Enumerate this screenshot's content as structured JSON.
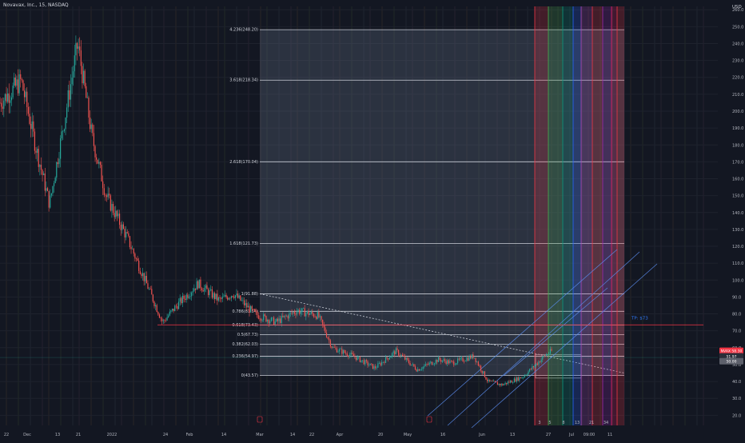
{
  "header": {
    "title": "Novavax, Inc., 15, NASDAQ",
    "currency": "USD"
  },
  "colors": {
    "background": "#131722",
    "up": "#26a69a",
    "down": "#ef5350",
    "fib_line": "#d9dde6",
    "fib_fill": "#5f6b80",
    "tp_line": "#f23645",
    "tp_label": "#3179f5",
    "channel": "#5b8def",
    "price_badge": "#f23645"
  },
  "chart_data": {
    "type": "candlestick",
    "instrument": "Novavax, Inc.",
    "interval": "15",
    "exchange": "NASDAQ",
    "y_axis": {
      "unit": "USD",
      "ylim": [
        14,
        262
      ],
      "ticks": [
        20,
        30,
        40,
        50,
        60,
        70,
        80,
        90,
        100,
        110,
        120,
        130,
        140,
        150,
        160,
        170,
        180,
        190,
        200,
        210,
        220,
        230,
        240,
        250,
        260
      ]
    },
    "x_axis": {
      "tick_labels": [
        "22",
        "Dec",
        "13",
        "21",
        "2022",
        "24",
        "Feb",
        "14",
        "Mar",
        "14",
        "22",
        "Apr",
        "20",
        "May",
        "16",
        "Jun",
        "13",
        "27",
        "Jul",
        "09:00",
        "11"
      ]
    },
    "price_path": [
      {
        "t": 0,
        "price": 205
      },
      {
        "t": 0.03,
        "price": 218
      },
      {
        "t": 0.05,
        "price": 180
      },
      {
        "t": 0.07,
        "price": 145
      },
      {
        "t": 0.09,
        "price": 192
      },
      {
        "t": 0.11,
        "price": 240
      },
      {
        "t": 0.13,
        "price": 185
      },
      {
        "t": 0.15,
        "price": 150
      },
      {
        "t": 0.18,
        "price": 125
      },
      {
        "t": 0.21,
        "price": 95
      },
      {
        "t": 0.23,
        "price": 75
      },
      {
        "t": 0.25,
        "price": 85
      },
      {
        "t": 0.28,
        "price": 98
      },
      {
        "t": 0.31,
        "price": 88
      },
      {
        "t": 0.33,
        "price": 92
      },
      {
        "t": 0.36,
        "price": 80
      },
      {
        "t": 0.39,
        "price": 75
      },
      {
        "t": 0.42,
        "price": 82
      },
      {
        "t": 0.45,
        "price": 79
      },
      {
        "t": 0.47,
        "price": 60
      },
      {
        "t": 0.5,
        "price": 55
      },
      {
        "t": 0.53,
        "price": 48
      },
      {
        "t": 0.56,
        "price": 58
      },
      {
        "t": 0.59,
        "price": 47
      },
      {
        "t": 0.62,
        "price": 53
      },
      {
        "t": 0.64,
        "price": 51
      },
      {
        "t": 0.67,
        "price": 55
      },
      {
        "t": 0.69,
        "price": 40
      },
      {
        "t": 0.71,
        "price": 38
      },
      {
        "t": 0.74,
        "price": 43
      },
      {
        "t": 0.77,
        "price": 55
      },
      {
        "t": 0.78,
        "price": 58
      }
    ],
    "fib_extension": {
      "levels": [
        {
          "ratio": "4.236",
          "price": 248.2,
          "label": "4.236(248.20)"
        },
        {
          "ratio": "3.618",
          "price": 218.34,
          "label": "3.618(218.34)"
        },
        {
          "ratio": "2.618",
          "price": 170.04,
          "label": "2.618(170.04)"
        },
        {
          "ratio": "1.618",
          "price": 121.73,
          "label": "1.618(121.73)"
        },
        {
          "ratio": "1",
          "price": 91.88,
          "label": "1(91.88)"
        },
        {
          "ratio": "0.786",
          "price": 81.54,
          "label": "0.786(81.54)"
        },
        {
          "ratio": "0.618",
          "price": 73.43,
          "label": "0.618(73.43)"
        },
        {
          "ratio": "0.5",
          "price": 67.73,
          "label": "0.5(67.73)"
        },
        {
          "ratio": "0.382",
          "price": 62.03,
          "label": "0.382(62.03)"
        },
        {
          "ratio": "0.236",
          "price": 54.97,
          "label": "0.236(54.97)"
        },
        {
          "ratio": "0",
          "price": 43.57,
          "label": "0(43.57)"
        }
      ]
    },
    "horizontal_levels": [
      {
        "name": "tp",
        "price": 73.5,
        "label": "TP: $73"
      }
    ],
    "price_scale_badges": [
      {
        "price": 58.2,
        "label": "NVAX 58.30",
        "color": "#f23645"
      },
      {
        "price": 54.9,
        "label": "51.97",
        "color": "#2a2e39"
      },
      {
        "price": 52.0,
        "label": "50.00",
        "color": "#5d606b"
      }
    ],
    "time_zones_labels": [
      "3",
      "5",
      "8",
      "13",
      "21",
      "34"
    ]
  }
}
